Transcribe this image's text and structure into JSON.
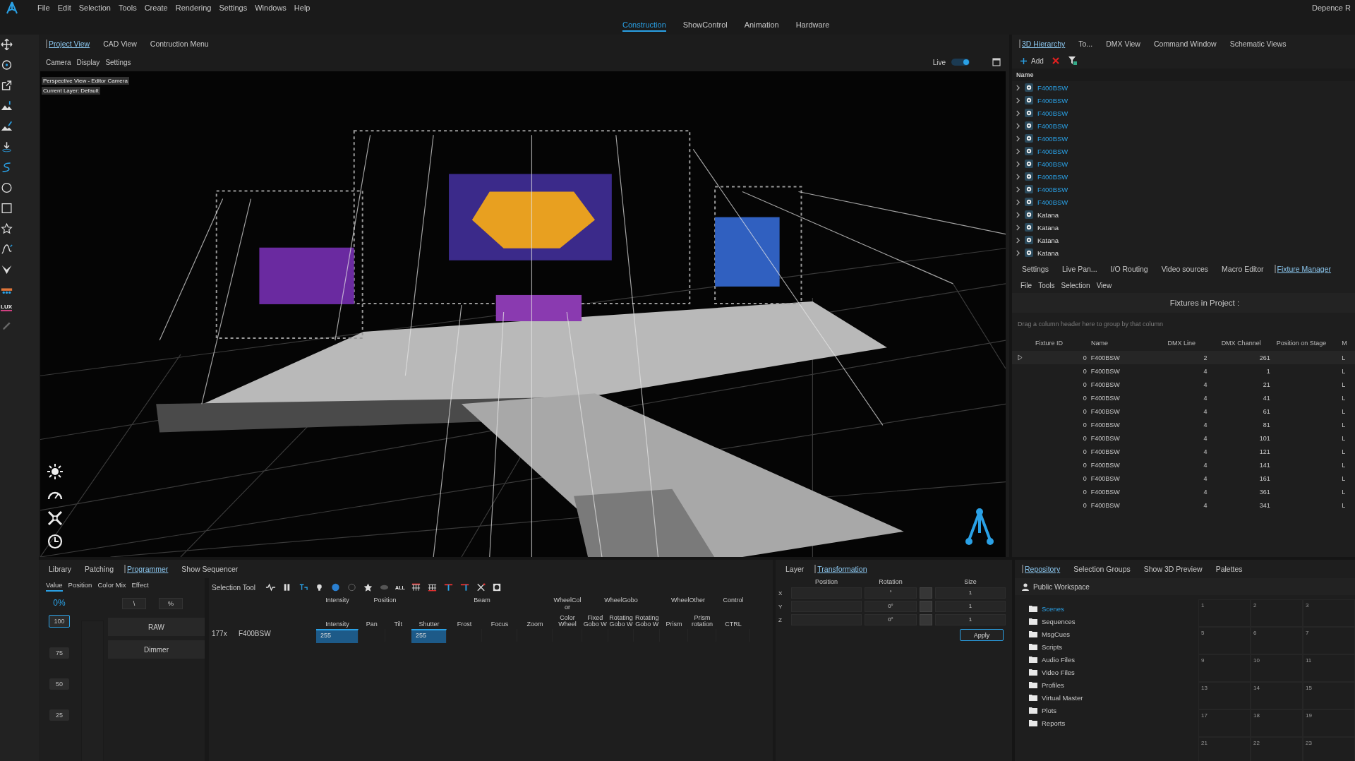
{
  "menu_bar": {
    "items": [
      "File",
      "Edit",
      "Selection",
      "Tools",
      "Create",
      "Rendering",
      "Settings",
      "Windows",
      "Help"
    ],
    "app_title": "Depence R"
  },
  "workspace_tabs": [
    {
      "label": "Construction",
      "selected": true
    },
    {
      "label": "ShowControl",
      "selected": false
    },
    {
      "label": "Animation",
      "selected": false
    },
    {
      "label": "Hardware",
      "selected": false
    }
  ],
  "tool_palette": {
    "lux_label": "LUX"
  },
  "view_tabs": [
    {
      "label": "Project View",
      "selected": true
    },
    {
      "label": "CAD View",
      "selected": false
    },
    {
      "label": "Contruction Menu",
      "selected": false
    }
  ],
  "view_menu": [
    "Camera",
    "Display",
    "Settings"
  ],
  "live": {
    "label": "Live",
    "on": true
  },
  "viewport": {
    "kind": "picture",
    "camera_label": "Perspective View - Editor Camera",
    "layer_label": "Current Layer: Default"
  },
  "hierarchy_tabs": [
    {
      "label": "3D Hierarchy",
      "selected": true
    },
    {
      "label": "To...",
      "selected": false
    },
    {
      "label": "DMX View",
      "selected": false
    },
    {
      "label": "Command Window",
      "selected": false
    },
    {
      "label": "Schematic Views",
      "selected": false
    }
  ],
  "hierarchy_toolbar": {
    "add": "Add"
  },
  "hierarchy": {
    "column": "Name",
    "items": [
      {
        "label": "F400BSW",
        "selected": true
      },
      {
        "label": "F400BSW",
        "selected": true
      },
      {
        "label": "F400BSW",
        "selected": true
      },
      {
        "label": "F400BSW",
        "selected": true
      },
      {
        "label": "F400BSW",
        "selected": true
      },
      {
        "label": "F400BSW",
        "selected": true
      },
      {
        "label": "F400BSW",
        "selected": true
      },
      {
        "label": "F400BSW",
        "selected": true
      },
      {
        "label": "F400BSW",
        "selected": true
      },
      {
        "label": "F400BSW",
        "selected": true
      },
      {
        "label": "Katana",
        "selected": false
      },
      {
        "label": "Katana",
        "selected": false
      },
      {
        "label": "Katana",
        "selected": false
      },
      {
        "label": "Katana",
        "selected": false
      }
    ]
  },
  "tool_tabs": [
    {
      "label": "Settings",
      "selected": false
    },
    {
      "label": "Live Pan...",
      "selected": false
    },
    {
      "label": "I/O Routing",
      "selected": false
    },
    {
      "label": "Video sources",
      "selected": false
    },
    {
      "label": "Macro Editor",
      "selected": false
    },
    {
      "label": "Fixture Manager",
      "selected": true
    }
  ],
  "fixture_menu": [
    "File",
    "Tools",
    "Selection",
    "View"
  ],
  "fixture_table": {
    "title": "Fixtures in Project :",
    "group_hint": "Drag a column header here to group by that column",
    "columns": [
      "Fixture ID",
      "Name",
      "DMX Line",
      "DMX Channel",
      "Position on Stage",
      "M"
    ],
    "rows": [
      {
        "current": true,
        "id": "0",
        "name": "F400BSW",
        "dmx_line": "2",
        "dmx_channel": "261",
        "column_6": "L"
      },
      {
        "current": false,
        "id": "0",
        "name": "F400BSW",
        "dmx_line": "4",
        "dmx_channel": "1",
        "column_6": "L"
      },
      {
        "current": false,
        "id": "0",
        "name": "F400BSW",
        "dmx_line": "4",
        "dmx_channel": "21",
        "column_6": "L"
      },
      {
        "current": false,
        "id": "0",
        "name": "F400BSW",
        "dmx_line": "4",
        "dmx_channel": "41",
        "column_6": "L"
      },
      {
        "current": false,
        "id": "0",
        "name": "F400BSW",
        "dmx_line": "4",
        "dmx_channel": "61",
        "column_6": "L"
      },
      {
        "current": false,
        "id": "0",
        "name": "F400BSW",
        "dmx_line": "4",
        "dmx_channel": "81",
        "column_6": "L"
      },
      {
        "current": false,
        "id": "0",
        "name": "F400BSW",
        "dmx_line": "4",
        "dmx_channel": "101",
        "column_6": "L"
      },
      {
        "current": false,
        "id": "0",
        "name": "F400BSW",
        "dmx_line": "4",
        "dmx_channel": "121",
        "column_6": "L"
      },
      {
        "current": false,
        "id": "0",
        "name": "F400BSW",
        "dmx_line": "4",
        "dmx_channel": "141",
        "column_6": "L"
      },
      {
        "current": false,
        "id": "0",
        "name": "F400BSW",
        "dmx_line": "4",
        "dmx_channel": "161",
        "column_6": "L"
      },
      {
        "current": false,
        "id": "0",
        "name": "F400BSW",
        "dmx_line": "4",
        "dmx_channel": "361",
        "column_6": "L"
      },
      {
        "current": false,
        "id": "0",
        "name": "F400BSW",
        "dmx_line": "4",
        "dmx_channel": "341",
        "column_6": "L"
      }
    ]
  },
  "bottom_tabs": [
    {
      "label": "Library",
      "selected": false
    },
    {
      "label": "Patching",
      "selected": false
    },
    {
      "label": "Programmer",
      "selected": true
    },
    {
      "label": "Show Sequencer",
      "selected": false
    }
  ],
  "programmer": {
    "subtabs": [
      {
        "label": "Value",
        "selected": true
      },
      {
        "label": "Position",
        "selected": false
      },
      {
        "label": "Color Mix",
        "selected": false
      },
      {
        "label": "Effect",
        "selected": false
      }
    ],
    "readout": "0%",
    "mode_buttons": [
      "\\",
      "%"
    ],
    "scale": [
      {
        "label": "100",
        "selected": true
      },
      {
        "label": "75",
        "selected": false
      },
      {
        "label": "50",
        "selected": false
      },
      {
        "label": "25",
        "selected": false
      }
    ],
    "feature_buttons": [
      "RAW",
      "Dimmer"
    ],
    "tool_label": "Selection Tool",
    "all_button": "ALL",
    "groups": [
      {
        "label": "Intensity",
        "columns": [
          {
            "label": "Intensity",
            "value": "255"
          }
        ]
      },
      {
        "label": "Position",
        "columns": [
          {
            "label": "Pan"
          },
          {
            "label": "Tilt"
          }
        ]
      },
      {
        "label": "Beam",
        "columns": [
          {
            "label": "Shutter",
            "value": "255"
          },
          {
            "label": "Frost"
          },
          {
            "label": "Focus"
          },
          {
            "label": "Zoom"
          }
        ]
      },
      {
        "label": "WheelColor",
        "columns": [
          {
            "label": "Color Wheel"
          }
        ]
      },
      {
        "label": "WheelGobo",
        "columns": [
          {
            "label": "Fixed Gobo W"
          },
          {
            "label": "Rotating Gobo W"
          },
          {
            "label": "Rotating Gobo W"
          }
        ]
      },
      {
        "label": "WheelOther",
        "columns": [
          {
            "label": "Prism"
          },
          {
            "label": "Prism rotation"
          }
        ]
      },
      {
        "label": "Control",
        "columns": [
          {
            "label": "CTRL"
          }
        ]
      }
    ],
    "row": {
      "count": "177x",
      "name": "F400BSW"
    }
  },
  "transform_tabs": [
    {
      "label": "Layer",
      "selected": false
    },
    {
      "label": "Transformation",
      "selected": true
    }
  ],
  "transform": {
    "headers": [
      "Position",
      "Rotation",
      "Size"
    ],
    "rows": [
      {
        "axis": "X",
        "rotation": "°",
        "size": "1"
      },
      {
        "axis": "Y",
        "rotation": "0°",
        "size": "1"
      },
      {
        "axis": "Z",
        "rotation": "0°",
        "size": "1"
      }
    ],
    "apply": "Apply"
  },
  "repository_tabs": [
    {
      "label": "Repository",
      "selected": true
    },
    {
      "label": "Selection Groups",
      "selected": false
    },
    {
      "label": "Show 3D Preview",
      "selected": false
    },
    {
      "label": "Palettes",
      "selected": false
    }
  ],
  "repository": {
    "workspace": "Public Workspace",
    "folders": [
      {
        "label": "Scenes",
        "selected": true
      },
      {
        "label": "Sequences",
        "selected": false
      },
      {
        "label": "MsgCues",
        "selected": false
      },
      {
        "label": "Scripts",
        "selected": false
      },
      {
        "label": "Audio Files",
        "selected": false
      },
      {
        "label": "Video Files",
        "selected": false
      },
      {
        "label": "Profiles",
        "selected": false
      },
      {
        "label": "Virtual Master",
        "selected": false
      },
      {
        "label": "Plots",
        "selected": false
      },
      {
        "label": "Reports",
        "selected": false
      }
    ],
    "slots": [
      "1",
      "2",
      "3",
      "5",
      "6",
      "7",
      "9",
      "10",
      "11",
      "13",
      "14",
      "15",
      "17",
      "18",
      "19",
      "21",
      "22",
      "23"
    ]
  }
}
